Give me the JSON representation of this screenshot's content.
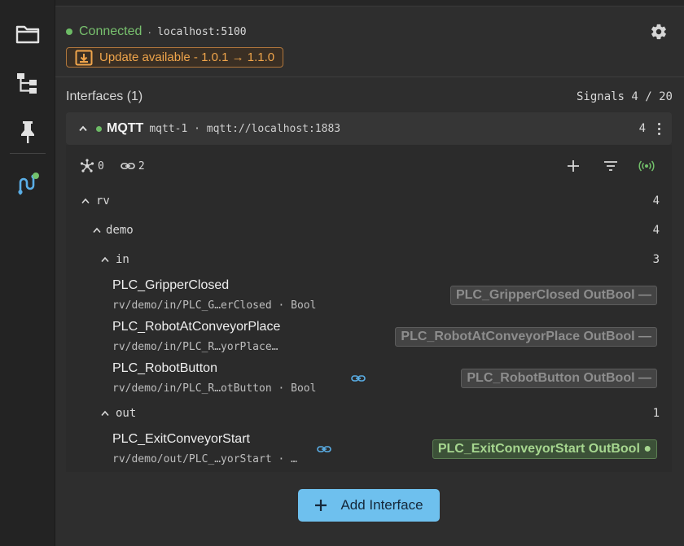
{
  "connection": {
    "status": "Connected",
    "separator": "·",
    "host": "localhost:5100",
    "update_label": "Update available - 1.0.1 → 1.1.0"
  },
  "interfaces": {
    "title": "Interfaces (1)",
    "signals_label": "Signals 4 / 20",
    "items": [
      {
        "name": "MQTT",
        "id_text": "mqtt-1 · mqtt://localhost:1883",
        "count": "4",
        "stats": {
          "nodes": "0",
          "links": "2"
        },
        "tree": {
          "rv": {
            "label": "rv",
            "count": "4"
          },
          "demo": {
            "label": "demo",
            "count": "4"
          },
          "in": {
            "label": "in",
            "count": "3"
          },
          "out": {
            "label": "out",
            "count": "1"
          }
        },
        "signals": [
          {
            "name": "PLC_GripperClosed",
            "path": "rv/demo/in/PLC_G…erClosed · Bool",
            "pill": "PLC_GripperClosed OutBool —"
          },
          {
            "name": "PLC_RobotAtConveyorPlace",
            "path": "rv/demo/in/PLC_R…yorPlace…",
            "pill": "PLC_RobotAtConveyorPlace OutBool —"
          },
          {
            "name": "PLC_RobotButton",
            "path": "rv/demo/in/PLC_R…otButton · Bool",
            "pill": "PLC_RobotButton OutBool —"
          },
          {
            "name": "PLC_ExitConveyorStart",
            "path": "rv/demo/out/PLC_…yorStart · …",
            "pill": "PLC_ExitConveyorStart OutBool ●"
          }
        ]
      }
    ],
    "add_label": "Add Interface"
  },
  "icons": {
    "activity": [
      "folder-icon",
      "hierarchy-icon",
      "pin-icon",
      "interfaces-icon"
    ],
    "toolbar": [
      "add-icon",
      "filter-icon",
      "broadcast-icon"
    ]
  },
  "colors": {
    "connected": "#78c06e",
    "update": "#f0a54b",
    "accent": "#6ec0ee",
    "active_signal": "#a6d68f"
  }
}
